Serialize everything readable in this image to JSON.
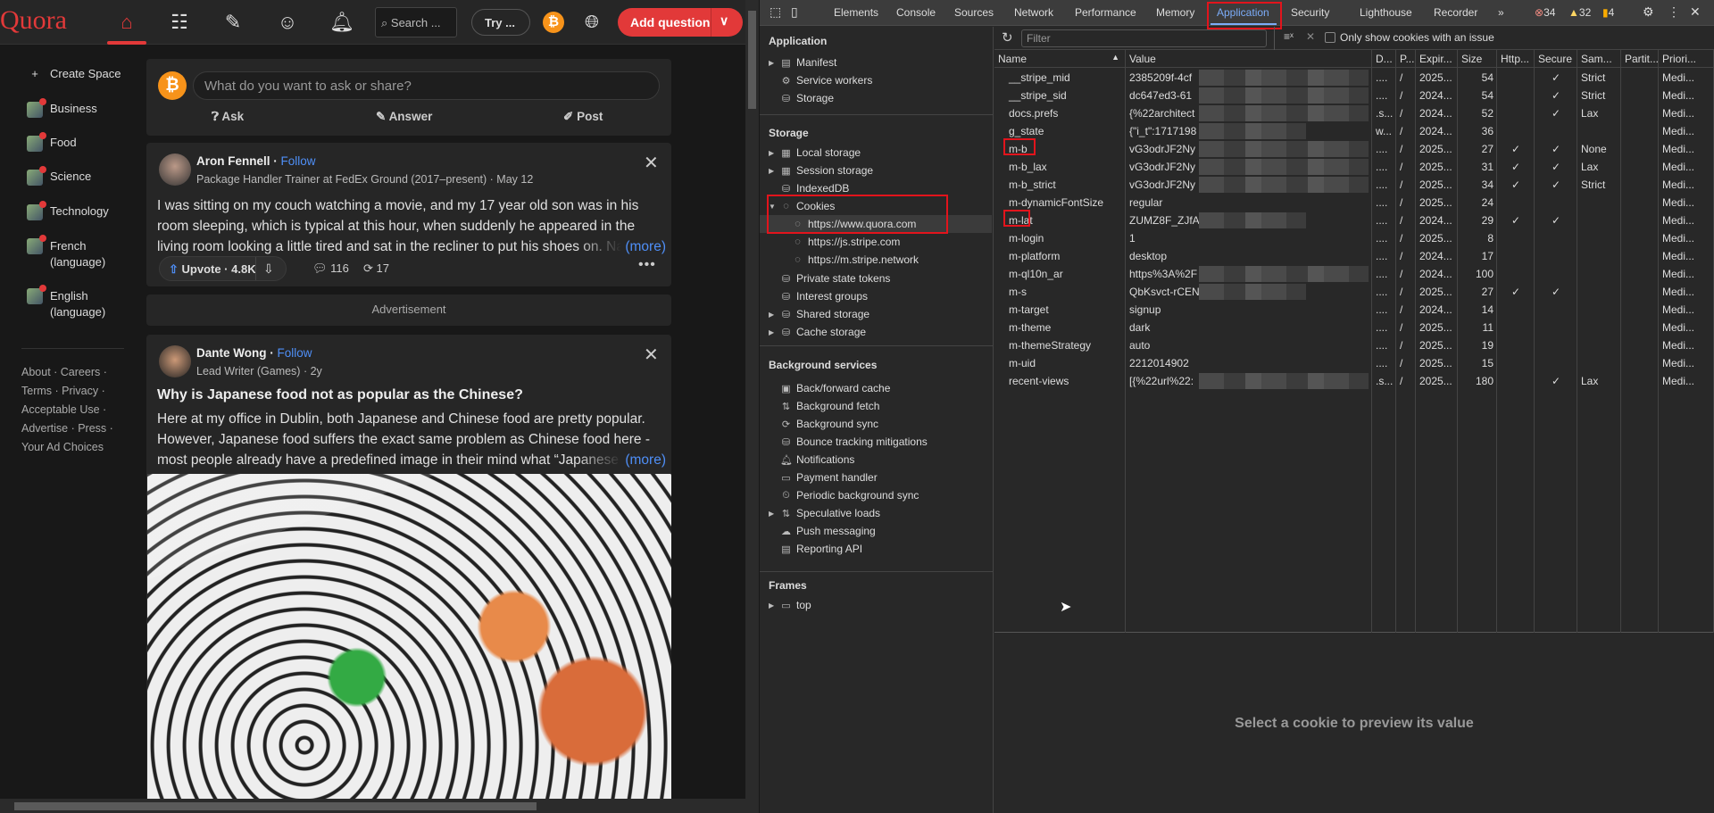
{
  "quora": {
    "logo": "Quora",
    "nav_icons": [
      "home-icon",
      "following-icon",
      "answer-icon",
      "spaces-icon",
      "notifications-icon"
    ],
    "search_placeholder": "Search ...",
    "try_label": "Try ...",
    "add_question": "Add question",
    "sidebar": {
      "create_space": "Create Space",
      "items": [
        {
          "label": "Business"
        },
        {
          "label": "Food"
        },
        {
          "label": "Science"
        },
        {
          "label": "Technology"
        },
        {
          "label": "French (language)"
        },
        {
          "label": "English (language)"
        }
      ]
    },
    "footer": [
      "About · Careers ·",
      "Terms · Privacy ·",
      "Acceptable Use ·",
      "Advertise · Press ·",
      "Your Ad Choices"
    ],
    "ask_box": {
      "placeholder": "What do you want to ask or share?",
      "ask": "Ask",
      "answer": "Answer",
      "post": "Post"
    },
    "posts": [
      {
        "author": "Aron Fennell",
        "follow": "Follow",
        "credential": "Package Handler Trainer at FedEx Ground (2017–present) · May 12",
        "text": "I was sitting on my couch watching a movie, and my 17 year old son was in his room sleeping, which is typical at this hour, when suddenly he appeared in the living room looking a little tired and sat in the recliner to put his shoes on. Naturally I was.",
        "more": "(more)",
        "upvote": "Upvote · 4.8K",
        "comments": "116",
        "shares": "17"
      },
      {
        "author": "Dante Wong",
        "follow": "Follow",
        "credential": "Lead Writer (Games) · 2y",
        "title": "Why is Japanese food not as popular as the Chinese?",
        "text": "Here at my office in Dublin, both Japanese and Chinese food are pretty popular. However, Japanese food suffers the exact same problem as Chinese food here - most people already have a predefined image in their mind what “Japanese food” a",
        "more": "(more)"
      }
    ],
    "advertisement": "Advertisement",
    "accent": "#e23939"
  },
  "devtools": {
    "tabs": [
      "Elements",
      "Console",
      "Sources",
      "Network",
      "Performance",
      "Memory",
      "Application",
      "Security",
      "Lighthouse",
      "Recorder"
    ],
    "active_tab": "Application",
    "more_tabs": "»",
    "errors": "34",
    "warnings": "32",
    "issues": "4",
    "sidebar": {
      "application_header": "Application",
      "application_items": [
        "Manifest",
        "Service workers",
        "Storage"
      ],
      "storage_header": "Storage",
      "storage_items": [
        "Local storage",
        "Session storage",
        "IndexedDB",
        "Cookies"
      ],
      "cookie_origins": [
        "https://www.quora.com",
        "https://js.stripe.com",
        "https://m.stripe.network"
      ],
      "storage_items2": [
        "Private state tokens",
        "Interest groups",
        "Shared storage",
        "Cache storage"
      ],
      "bg_header": "Background services",
      "bg_items": [
        "Back/forward cache",
        "Background fetch",
        "Background sync",
        "Bounce tracking mitigations",
        "Notifications",
        "Payment handler",
        "Periodic background sync",
        "Speculative loads",
        "Push messaging",
        "Reporting API"
      ],
      "frames_header": "Frames",
      "frames_items": [
        "top"
      ]
    },
    "toolbar": {
      "filter_placeholder": "Filter",
      "only_issues_label": "Only show cookies with an issue"
    },
    "columns": [
      "Name",
      "Value",
      "D...",
      "P...",
      "Expir...",
      "Size",
      "Http...",
      "Secure",
      "Sam...",
      "Partit...",
      "Priori..."
    ],
    "rows": [
      {
        "name": "__stripe_mid",
        "value": "2385209f-4cf",
        "d": "....",
        "p": "/",
        "exp": "2025...",
        "size": "54",
        "http": "",
        "secure": "✓",
        "same": "Strict",
        "prio": "Medi...",
        "hidden": true
      },
      {
        "name": "__stripe_sid",
        "value": "dc647ed3-61",
        "d": "....",
        "p": "/",
        "exp": "2024...",
        "size": "54",
        "http": "",
        "secure": "✓",
        "same": "Strict",
        "prio": "Medi...",
        "hidden": true
      },
      {
        "name": "docs.prefs",
        "value": "{%22architect",
        "d": ".s...",
        "p": "/",
        "exp": "2024...",
        "size": "52",
        "http": "",
        "secure": "✓",
        "same": "Lax",
        "prio": "Medi...",
        "hidden": true
      },
      {
        "name": "g_state",
        "value": "{\"i_t\":1717198",
        "d": "w...",
        "p": "/",
        "exp": "2024...",
        "size": "36",
        "http": "",
        "secure": "",
        "same": "",
        "prio": "Medi...",
        "hidden": true
      },
      {
        "name": "m-b",
        "value": "vG3odrJF2Ny",
        "d": "....",
        "p": "/",
        "exp": "2025...",
        "size": "27",
        "http": "✓",
        "secure": "✓",
        "same": "None",
        "prio": "Medi...",
        "hidden": true,
        "highlight": true
      },
      {
        "name": "m-b_lax",
        "value": "vG3odrJF2Ny",
        "d": "....",
        "p": "/",
        "exp": "2025...",
        "size": "31",
        "http": "✓",
        "secure": "✓",
        "same": "Lax",
        "prio": "Medi...",
        "hidden": true
      },
      {
        "name": "m-b_strict",
        "value": "vG3odrJF2Ny",
        "d": "....",
        "p": "/",
        "exp": "2025...",
        "size": "34",
        "http": "✓",
        "secure": "✓",
        "same": "Strict",
        "prio": "Medi...",
        "hidden": true
      },
      {
        "name": "m-dynamicFontSize",
        "value": "regular",
        "d": "....",
        "p": "/",
        "exp": "2025...",
        "size": "24",
        "http": "",
        "secure": "",
        "same": "",
        "prio": "Medi..."
      },
      {
        "name": "m-lat",
        "value": "ZUMZ8F_ZJfA",
        "d": "....",
        "p": "/",
        "exp": "2024...",
        "size": "29",
        "http": "✓",
        "secure": "✓",
        "same": "",
        "prio": "Medi...",
        "hidden": true,
        "highlight": true
      },
      {
        "name": "m-login",
        "value": "1",
        "d": "....",
        "p": "/",
        "exp": "2025...",
        "size": "8",
        "http": "",
        "secure": "",
        "same": "",
        "prio": "Medi..."
      },
      {
        "name": "m-platform",
        "value": "desktop",
        "d": "....",
        "p": "/",
        "exp": "2024...",
        "size": "17",
        "http": "",
        "secure": "",
        "same": "",
        "prio": "Medi..."
      },
      {
        "name": "m-ql10n_ar",
        "value": "https%3A%2F",
        "d": "....",
        "p": "/",
        "exp": "2024...",
        "size": "100",
        "http": "",
        "secure": "",
        "same": "",
        "prio": "Medi...",
        "hidden": true
      },
      {
        "name": "m-s",
        "value": "QbKsvct-rCEN",
        "d": "....",
        "p": "/",
        "exp": "2025...",
        "size": "27",
        "http": "✓",
        "secure": "✓",
        "same": "",
        "prio": "Medi...",
        "hidden": true
      },
      {
        "name": "m-target",
        "value": "signup",
        "d": "....",
        "p": "/",
        "exp": "2024...",
        "size": "14",
        "http": "",
        "secure": "",
        "same": "",
        "prio": "Medi..."
      },
      {
        "name": "m-theme",
        "value": "dark",
        "d": "....",
        "p": "/",
        "exp": "2025...",
        "size": "11",
        "http": "",
        "secure": "",
        "same": "",
        "prio": "Medi..."
      },
      {
        "name": "m-themeStrategy",
        "value": "auto",
        "d": "....",
        "p": "/",
        "exp": "2025...",
        "size": "19",
        "http": "",
        "secure": "",
        "same": "",
        "prio": "Medi..."
      },
      {
        "name": "m-uid",
        "value": "2212014902",
        "d": "....",
        "p": "/",
        "exp": "2025...",
        "size": "15",
        "http": "",
        "secure": "",
        "same": "",
        "prio": "Medi..."
      },
      {
        "name": "recent-views",
        "value": "[{%22url%22:",
        "d": ".s...",
        "p": "/",
        "exp": "2025...",
        "size": "180",
        "http": "",
        "secure": "✓",
        "same": "Lax",
        "prio": "Medi...",
        "hidden": true
      }
    ],
    "preview_text": "Select a cookie to preview its value",
    "accent": "#7cacf8"
  }
}
